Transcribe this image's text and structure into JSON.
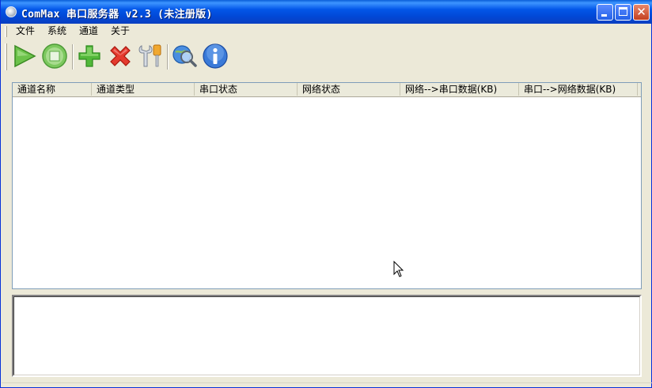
{
  "window": {
    "title": "ComMax 串口服务器 v2.3 (未注册版)",
    "minimize_label": "",
    "close_glyph": "✕"
  },
  "menu": {
    "items": [
      {
        "label": "文件"
      },
      {
        "label": "系统"
      },
      {
        "label": "通道"
      },
      {
        "label": "关于"
      }
    ]
  },
  "toolbar": {
    "tools": [
      {
        "icon": "play-icon",
        "color": "#3aa02a"
      },
      {
        "icon": "stop-icon",
        "color": "#3aa02a"
      },
      {
        "icon": "add-icon",
        "color": "#2f9e22"
      },
      {
        "icon": "delete-icon",
        "color": "#d8261d"
      },
      {
        "icon": "settings-tools-icon",
        "color": "#e8a020"
      },
      {
        "icon": "search-globe-icon",
        "color": "#2a6fc8"
      },
      {
        "icon": "info-icon",
        "color": "#2a6fc8"
      }
    ]
  },
  "table": {
    "columns": [
      {
        "label": "通道名称"
      },
      {
        "label": "通道类型"
      },
      {
        "label": "串口状态"
      },
      {
        "label": "网络状态"
      },
      {
        "label": "网络-->串口数据(KB)"
      },
      {
        "label": "串口-->网络数据(KB)"
      }
    ],
    "rows": []
  },
  "colors": {
    "titlebar": "#0148d6",
    "background": "#ece9d8",
    "header": "#ebeadb"
  }
}
